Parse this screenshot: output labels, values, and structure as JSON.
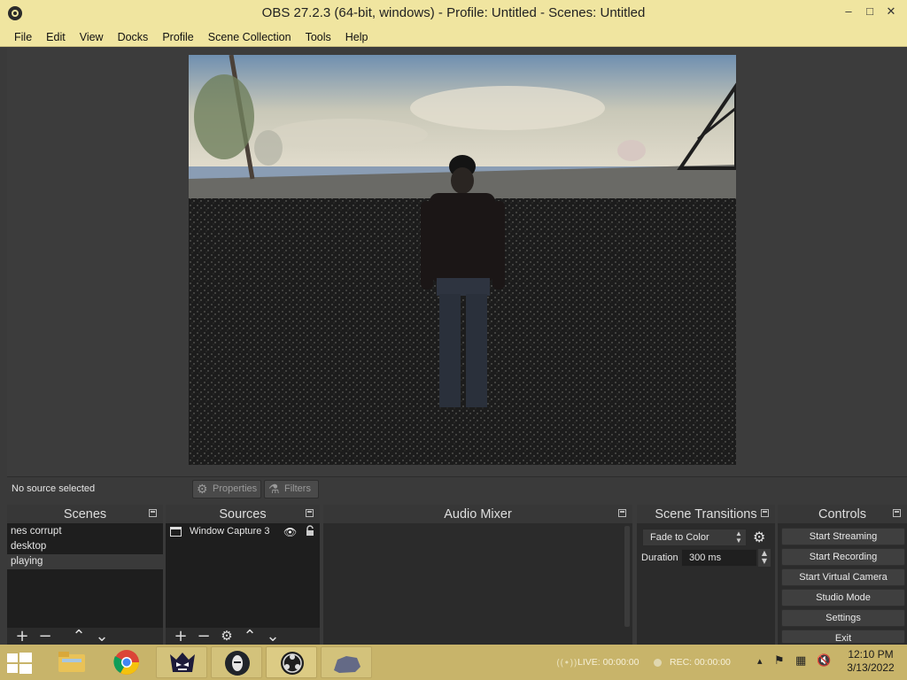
{
  "window": {
    "title": "OBS 27.2.3 (64-bit, windows) - Profile: Untitled - Scenes: Untitled",
    "minimize": "–",
    "maximize": "□",
    "close": "✕"
  },
  "menu": [
    "File",
    "Edit",
    "View",
    "Docks",
    "Profile",
    "Scene Collection",
    "Tools",
    "Help"
  ],
  "source_strip": {
    "status": "No source selected",
    "properties_label": "Properties",
    "filters_label": "Filters"
  },
  "scenes": {
    "title": "Scenes",
    "items": [
      "nes corrupt",
      "desktop",
      "playing"
    ],
    "selected": "playing"
  },
  "sources": {
    "title": "Sources",
    "items": [
      {
        "name": "Window Capture 3",
        "visible": true,
        "locked": false
      }
    ]
  },
  "audio_mixer": {
    "title": "Audio Mixer"
  },
  "transitions": {
    "title": "Scene Transitions",
    "selected": "Fade to Color",
    "duration_label": "Duration",
    "duration_value": "300 ms"
  },
  "controls": {
    "title": "Controls",
    "buttons": [
      "Start Streaming",
      "Start Recording",
      "Start Virtual Camera",
      "Studio Mode",
      "Settings",
      "Exit"
    ]
  },
  "taskbar": {
    "live": "LIVE: 00:00:00",
    "rec": "REC: 00:00:00",
    "time": "12:10 PM",
    "date": "3/13/2022",
    "apps": [
      "file-explorer",
      "chrome",
      "game-app",
      "mask-app",
      "obs",
      "game-window"
    ]
  },
  "colors": {
    "titlebar": "#f0e5a0",
    "taskbar": "#c8b46a",
    "panel": "#2b2b2b",
    "list_bg": "#1e1e1e"
  }
}
